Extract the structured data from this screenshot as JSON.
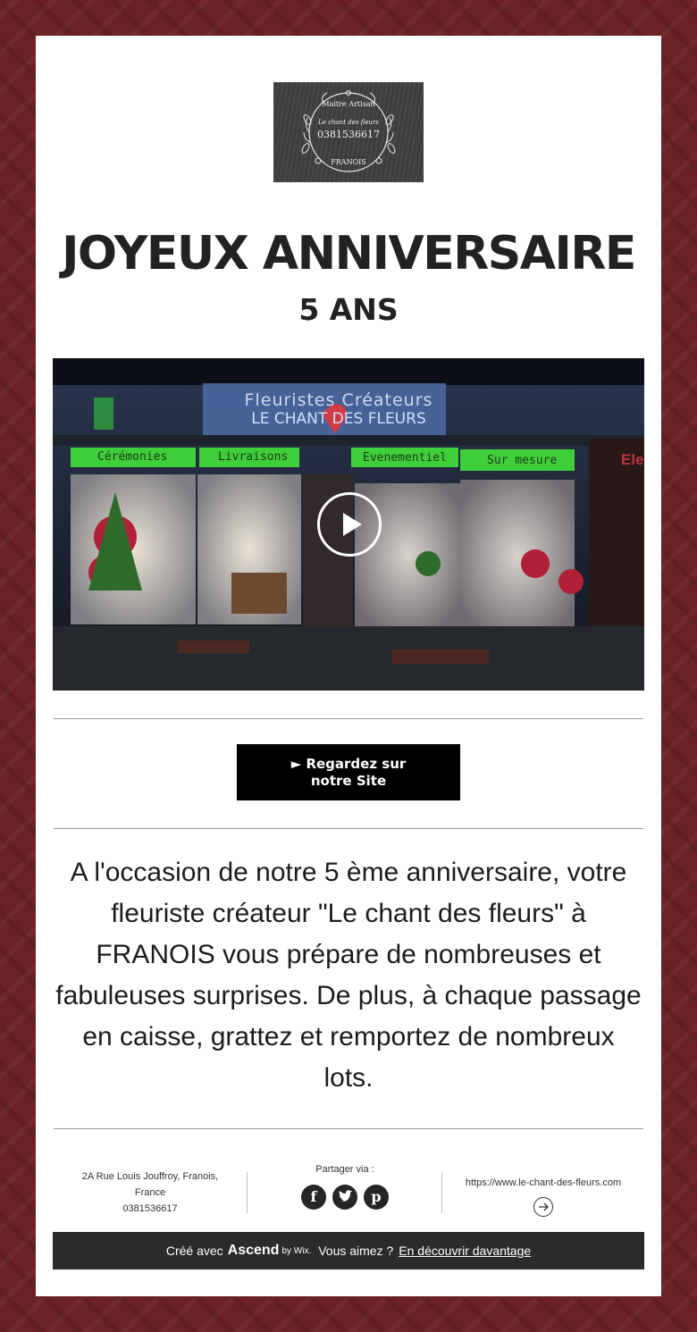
{
  "logo": {
    "line1": "Maitre Artisan",
    "line2": "Le chant des fleurs",
    "line3": "0381536617",
    "line4": "FRANOIS"
  },
  "headline": {
    "title": "JOYEUX ANNIVERSAIRE",
    "subtitle": "5 ANS"
  },
  "video": {
    "sign_top": "Fleuristes Créateurs",
    "sign_bottom": "LE CHANT DES FLEURS",
    "banners": [
      "Cérémonies",
      "Livraisons",
      "Evenementiel",
      "Sur mesure"
    ],
    "store_sign": "Ele",
    "play_icon": "play-icon"
  },
  "cta": {
    "label": "► Regardez sur notre Site"
  },
  "message": {
    "text": "A l'occasion de notre 5 ème anniversaire, votre fleuriste créateur \"Le chant des fleurs\" à FRANOIS vous prépare de nombreuses et fabuleuses surprises. De plus, à chaque passage en caisse, grattez et remportez de nombreux lots."
  },
  "footer": {
    "address_line1": "2A Rue Louis Jouffroy, Franois,",
    "address_line2": "France",
    "phone": "0381536617",
    "share_label": "Partager via :",
    "social": [
      "facebook-icon",
      "twitter-icon",
      "pinterest-icon"
    ],
    "website": "https://www.le-chant-des-fleurs.com",
    "arrow_icon": "arrow-right-icon"
  },
  "wix_bar": {
    "created_with": "Créé avec",
    "brand": "Ascend",
    "by": "by Wix.",
    "question": "Vous aimez ?",
    "link": "En découvrir davantage"
  },
  "colors": {
    "background": "#6b2226",
    "card": "#ffffff",
    "button": "#000000",
    "footer_bar": "#2b2b2b"
  }
}
